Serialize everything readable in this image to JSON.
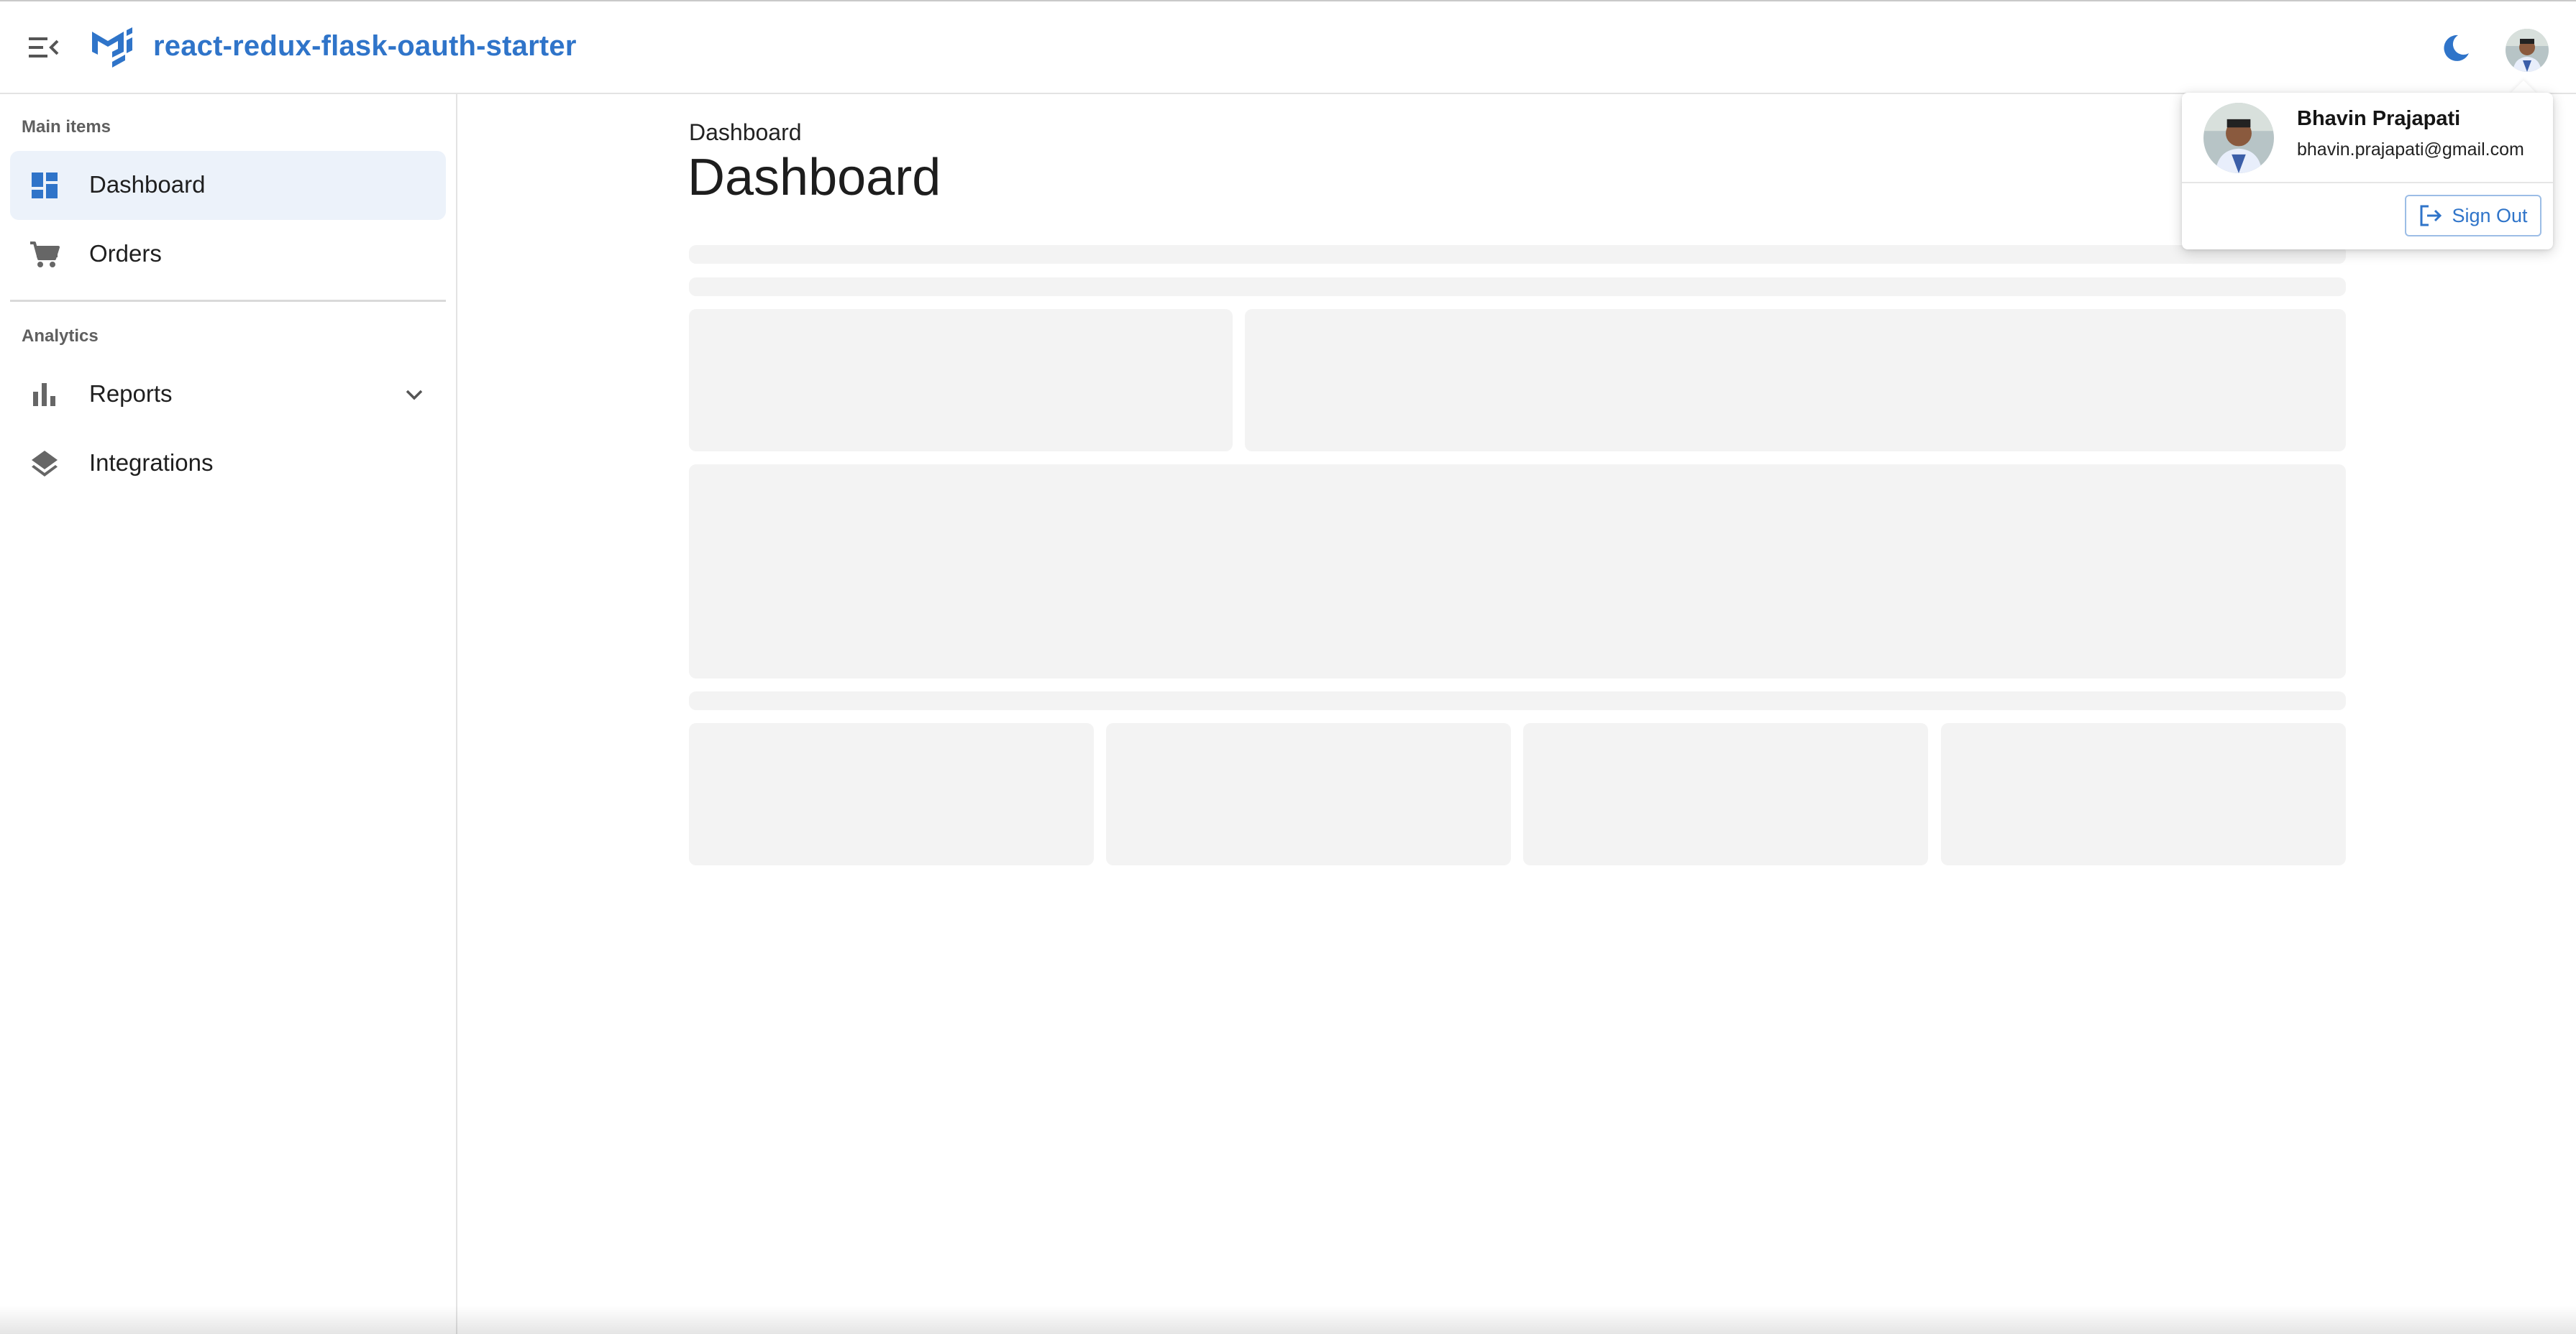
{
  "app": {
    "title": "react-redux-flask-oauth-starter",
    "brand_color": "#2f74c9"
  },
  "header": {
    "menu_icon": "menu-open-icon",
    "logo_icon": "mui-logo-icon",
    "theme_toggle_icon": "moon-icon"
  },
  "sidebar": {
    "sections": [
      {
        "header": "Main items",
        "items": [
          {
            "label": "Dashboard",
            "icon": "dashboard-icon",
            "selected": true
          },
          {
            "label": "Orders",
            "icon": "cart-icon",
            "selected": false
          }
        ]
      },
      {
        "header": "Analytics",
        "items": [
          {
            "label": "Reports",
            "icon": "bar-chart-icon",
            "expandable": true
          },
          {
            "label": "Integrations",
            "icon": "layers-icon"
          }
        ]
      }
    ]
  },
  "main": {
    "breadcrumb": "Dashboard",
    "title": "Dashboard"
  },
  "account_popover": {
    "name": "Bhavin Prajapati",
    "email": "bhavin.prajapati@gmail.com",
    "sign_out_label": "Sign Out"
  },
  "colors": {
    "selected_bg": "#ecf2fa",
    "skeleton": "#f3f3f3",
    "icon_gray": "#6b6b6b"
  }
}
